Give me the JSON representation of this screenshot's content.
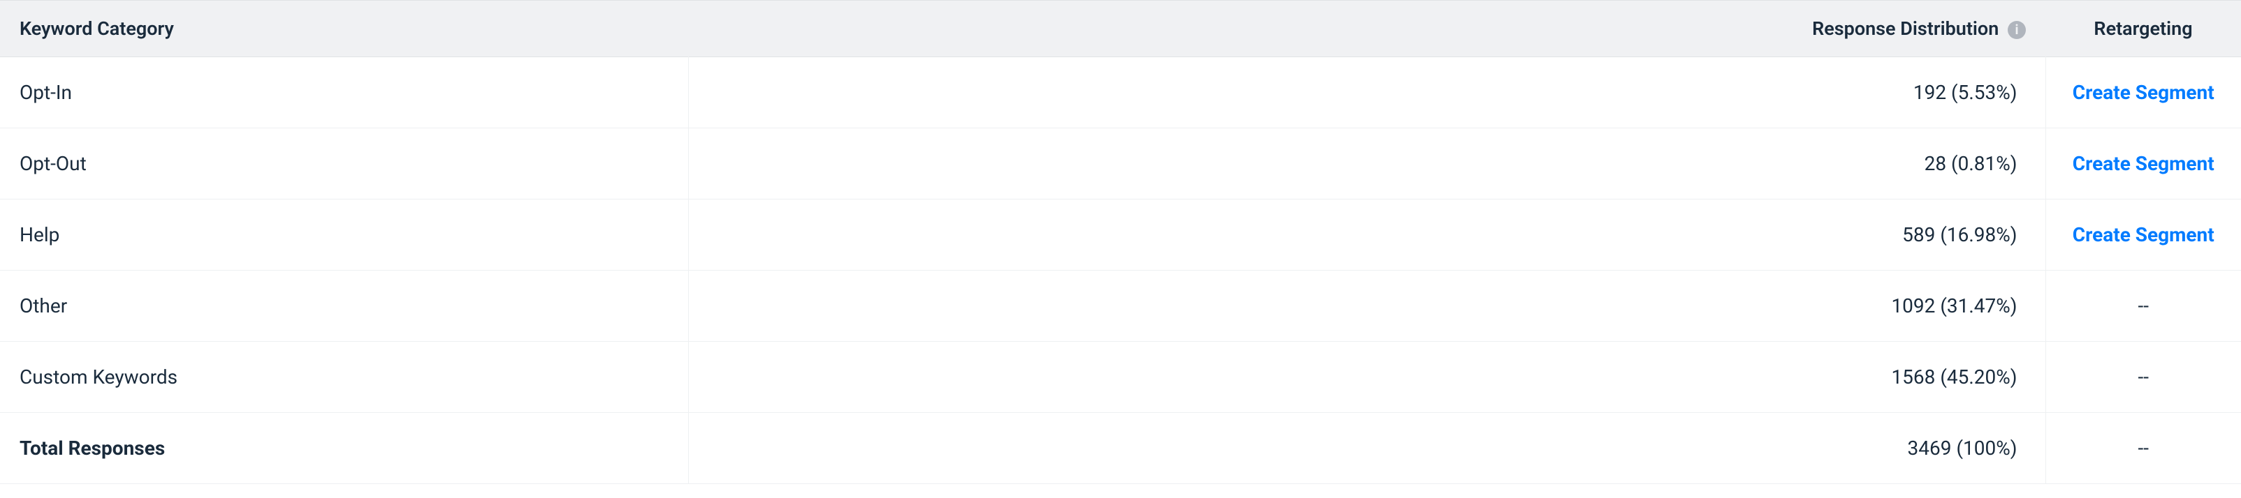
{
  "headers": {
    "category": "Keyword Category",
    "distribution": "Response Distribution",
    "retargeting": "Retargeting"
  },
  "rows": [
    {
      "category": "Opt-In",
      "count": 192,
      "percent": "5.53%",
      "retarget_label": "Create Segment",
      "retarget_link": true
    },
    {
      "category": "Opt-Out",
      "count": 28,
      "percent": "0.81%",
      "retarget_label": "Create Segment",
      "retarget_link": true
    },
    {
      "category": "Help",
      "count": 589,
      "percent": "16.98%",
      "retarget_label": "Create Segment",
      "retarget_link": true
    },
    {
      "category": "Other",
      "count": 1092,
      "percent": "31.47%",
      "retarget_label": "--",
      "retarget_link": false
    },
    {
      "category": "Custom Keywords",
      "count": 1568,
      "percent": "45.20%",
      "retarget_label": "--",
      "retarget_link": false
    }
  ],
  "total": {
    "label": "Total Responses",
    "count": 3469,
    "percent": "100%",
    "retarget_label": "--"
  }
}
